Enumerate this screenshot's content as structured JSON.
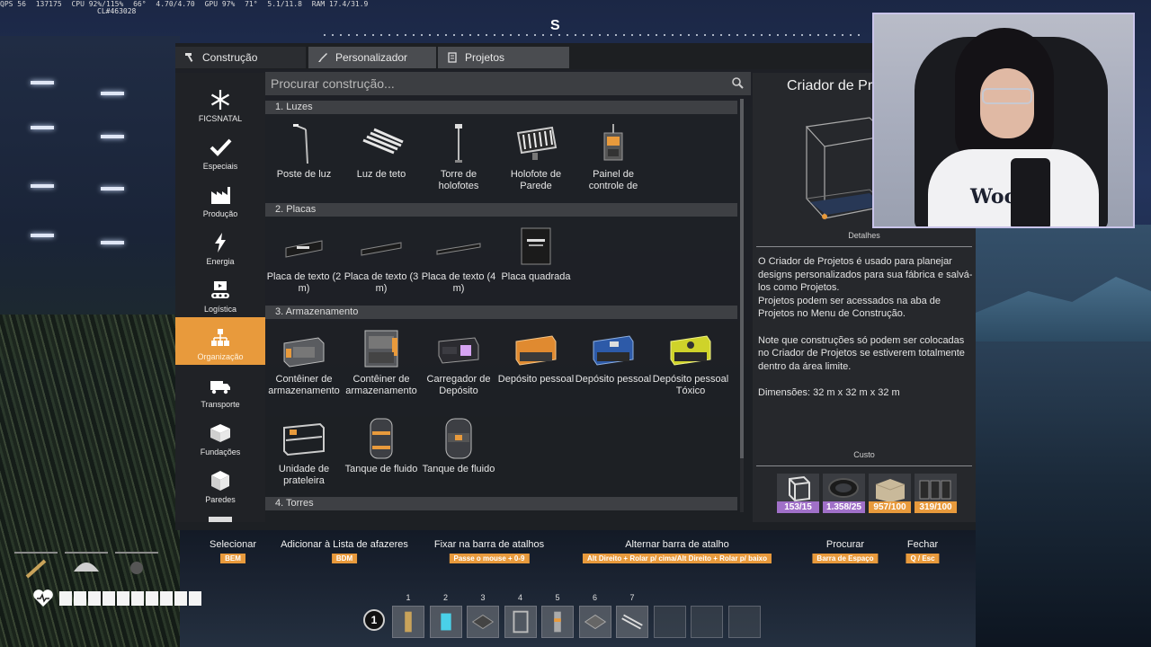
{
  "stats": {
    "fps": "QPS 56",
    "frame": "137175",
    "cpu": "CPU 92%/115%",
    "cpu_temp": "66°",
    "freq": "4.70/4.70",
    "gpu": "GPU 97%",
    "gpu_temp": "71°",
    "vram": "5.1/11.8",
    "ram": "RAM 17.4/31.9",
    "build": "CL#463028"
  },
  "compass": {
    "heading": "S"
  },
  "tabs": [
    {
      "label": "Construção",
      "icon": "hammer-icon"
    },
    {
      "label": "Personalizador",
      "icon": "brush-icon"
    },
    {
      "label": "Projetos",
      "icon": "blueprint-icon"
    }
  ],
  "categories": [
    {
      "label": "FICSNATAL",
      "icon": "snowflake-icon"
    },
    {
      "label": "Especiais",
      "icon": "checkmark-icon"
    },
    {
      "label": "Produção",
      "icon": "factory-icon"
    },
    {
      "label": "Energia",
      "icon": "lightning-icon"
    },
    {
      "label": "Logística",
      "icon": "conveyor-icon"
    },
    {
      "label": "Organização",
      "icon": "organization-icon",
      "active": true
    },
    {
      "label": "Transporte",
      "icon": "truck-icon"
    },
    {
      "label": "Fundações",
      "icon": "foundation-icon"
    },
    {
      "label": "Paredes",
      "icon": "wall-icon"
    }
  ],
  "search": {
    "placeholder": "Procurar construção..."
  },
  "sections": [
    {
      "title": "1.  Luzes",
      "items": [
        "Poste de luz",
        "Luz de teto",
        "Torre de holofotes",
        "Holofote de Parede",
        "Painel de controle de"
      ]
    },
    {
      "title": "2.  Placas",
      "items": [
        "Placa de texto (2 m)",
        "Placa de texto (3 m)",
        "Placa de texto (4 m)",
        "Placa quadrada"
      ]
    },
    {
      "title": "3.  Armazenamento",
      "items": [
        "Contêiner de armazenamento",
        "Contêiner de armazenamento",
        "Carregador de Depósito",
        "Depósito pessoal",
        "Depósito pessoal",
        "Depósito pessoal Tóxico",
        "Unidade de prateleira",
        "Tanque de fluido",
        "Tanque de fluido"
      ]
    },
    {
      "title": "4.  Torres",
      "items": []
    }
  ],
  "detail": {
    "title": "Criador de Projetos",
    "image_label": "Detalhes",
    "description": [
      "O Criador de Projetos é usado para planejar designs personalizados para sua fábrica e salvá-los como Projetos.",
      "Projetos podem ser acessados na aba de Projetos no Menu de Construção.",
      "Note que construções só podem ser colocadas no Criador de Projetos se estiverem totalmente dentro da área limite.",
      "Dimensões: 32 m x 32 m x 32 m"
    ],
    "cost_label": "Custo",
    "costs": [
      {
        "value": "153/15",
        "color": "#a070c8",
        "icon": "frame-icon"
      },
      {
        "value": "1.358/25",
        "color": "#a070c8",
        "icon": "cable-icon"
      },
      {
        "value": "957/100",
        "color": "#e89a3c",
        "icon": "concrete-icon"
      },
      {
        "value": "319/100",
        "color": "#e89a3c",
        "icon": "steel-beam-icon"
      }
    ]
  },
  "hints": [
    {
      "label": "Selecionar",
      "key": "BEM"
    },
    {
      "label": "Adicionar à Lista de afazeres",
      "key": "BDM"
    },
    {
      "label": "Fixar na barra de atalhos",
      "key": "Passe o mouse + 0-9"
    },
    {
      "label": "Alternar barra de atalho",
      "key": "Alt Direito + Rolar p/ cima/Alt Direito + Rolar p/ baixo"
    },
    {
      "label": "Procurar",
      "key": "Barra de Espaço"
    },
    {
      "label": "Fechar",
      "key": "Q / Esc"
    }
  ],
  "hotbar": {
    "page": "1",
    "slots": [
      "1",
      "2",
      "3",
      "4",
      "5",
      "6",
      "7",
      "",
      "",
      ""
    ]
  },
  "health": {
    "segments": 10
  },
  "webcam": {
    "shirt_text": "Woo"
  }
}
